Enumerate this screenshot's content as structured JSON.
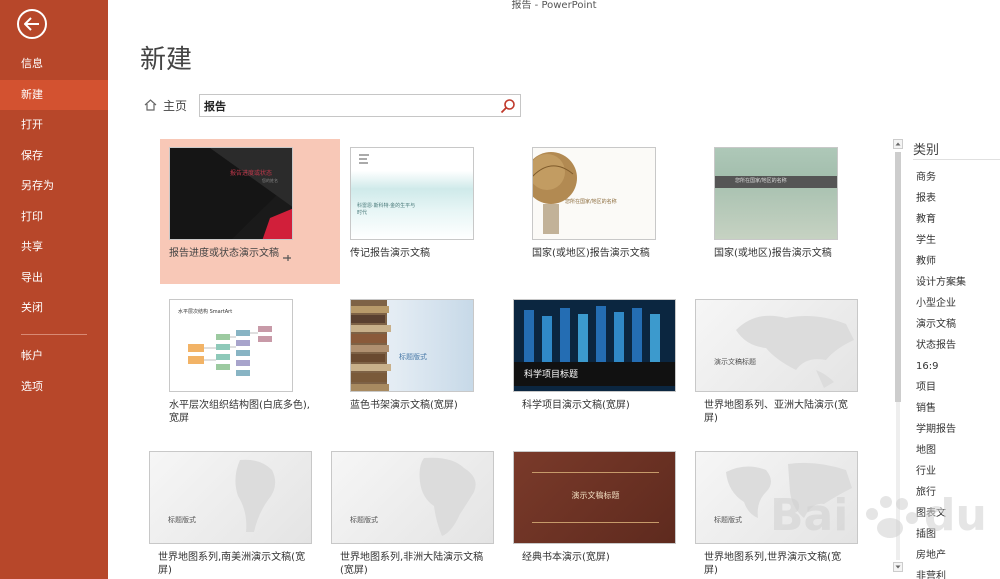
{
  "window": {
    "title": "报告 - PowerPoint"
  },
  "sidebar": {
    "items": [
      {
        "label": "信息"
      },
      {
        "label": "新建"
      },
      {
        "label": "打开"
      },
      {
        "label": "保存"
      },
      {
        "label": "另存为"
      },
      {
        "label": "打印"
      },
      {
        "label": "共享"
      },
      {
        "label": "导出"
      },
      {
        "label": "关闭"
      },
      {
        "label": "帐户"
      },
      {
        "label": "选项"
      }
    ],
    "active_index": 1,
    "accent_color": "#b7472a",
    "active_color": "#d35230"
  },
  "main": {
    "title": "新建",
    "home_label": "主页",
    "search": {
      "value": "报告"
    }
  },
  "templates": [
    {
      "label": "报告进度或状态演示文稿",
      "thumb_text": "报告进度或状态",
      "thumb_sub": "您的姓名",
      "selected": true
    },
    {
      "label": "传记报告演示文稿",
      "thumb_text": "科雷恩·斯科特·金的生平与时代"
    },
    {
      "label": "国家(或地区)报告演示文稿",
      "thumb_text": "您所在国家/地区的名称"
    },
    {
      "label": "国家(或地区)报告演示文稿",
      "thumb_text": "您所在国家/地区的名称"
    },
    {
      "label": "水平层次组织结构图(白底多色),宽屏",
      "thumb_text": "水平层次结构 SmartArt"
    },
    {
      "label": "蓝色书架演示文稿(宽屏)",
      "thumb_text": "标题版式"
    },
    {
      "label": "科学项目演示文稿(宽屏)",
      "thumb_text": "科学项目标题"
    },
    {
      "label": "世界地图系列、亚洲大陆演示(宽屏)",
      "thumb_text": "演示文稿标题"
    },
    {
      "label": "世界地图系列,南美洲演示文稿(宽屏)",
      "thumb_text": "标题版式"
    },
    {
      "label": "世界地图系列,非洲大陆演示文稿(宽屏)",
      "thumb_text": "标题版式"
    },
    {
      "label": "经典书本演示(宽屏)",
      "thumb_text": "演示文稿标题"
    },
    {
      "label": "世界地图系列,世界演示文稿(宽屏)",
      "thumb_text": "标题版式"
    }
  ],
  "categories": {
    "title": "类别",
    "items": [
      "商务",
      "报表",
      "教育",
      "学生",
      "教师",
      "设计方案集",
      "小型企业",
      "演示文稿",
      "状态报告",
      "16:9",
      "项目",
      "销售",
      "学期报告",
      "地图",
      "行业",
      "旅行",
      "图表文",
      "插图",
      "房地产",
      "非营利"
    ]
  }
}
